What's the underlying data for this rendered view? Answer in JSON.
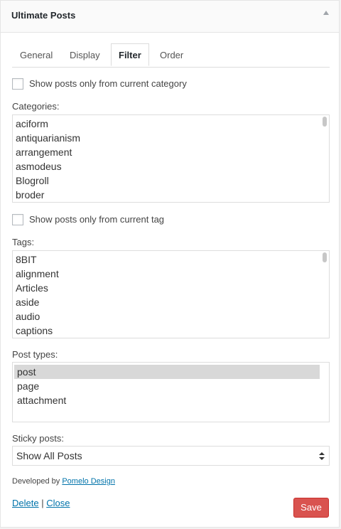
{
  "widget": {
    "title": "Ultimate Posts"
  },
  "tabs": [
    {
      "label": "General"
    },
    {
      "label": "Display"
    },
    {
      "label": "Filter"
    },
    {
      "label": "Order"
    }
  ],
  "filter": {
    "current_category_label": "Show posts only from current category",
    "categories_label": "Categories:",
    "categories": [
      "aciform",
      "antiquarianism",
      "arrangement",
      "asmodeus",
      "Blogroll",
      "broder"
    ],
    "current_tag_label": "Show posts only from current tag",
    "tags_label": "Tags:",
    "tags": [
      "8BIT",
      "alignment",
      "Articles",
      "aside",
      "audio",
      "captions"
    ],
    "post_types_label": "Post types:",
    "post_types": [
      "post",
      "page",
      "attachment"
    ],
    "sticky_label": "Sticky posts:",
    "sticky_value": "Show All Posts"
  },
  "footer": {
    "developed_by": "Developed by",
    "developer_link": "Pomelo Design",
    "delete_label": "Delete",
    "separator": "|",
    "close_label": "Close",
    "save_label": "Save"
  },
  "colors": {
    "save_button": "#d9534f",
    "link": "#0073aa",
    "selected_option": "#d8d8d8"
  }
}
